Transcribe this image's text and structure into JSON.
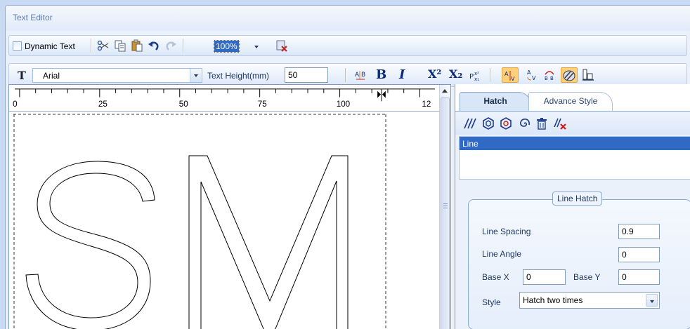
{
  "window": {
    "title": "Text Editor"
  },
  "toolbar1": {
    "dynamic_text_label": "Dynamic Text",
    "zoom_value": "100%",
    "icons": [
      "cut-icon",
      "copy-icon",
      "paste-icon",
      "undo-icon",
      "redo-icon",
      "clear-icon"
    ]
  },
  "toolbar2": {
    "font_name": "Arial",
    "text_height_label": "Text Height(mm)",
    "text_height_value": "50",
    "bold_glyph": "B",
    "italic_glyph": "I",
    "superscript_glyph": "X²",
    "subscript_glyph": "X₂"
  },
  "ruler": {
    "labels": [
      "0",
      "25",
      "50",
      "75",
      "100",
      "12"
    ]
  },
  "panel": {
    "tabs": [
      {
        "label": "Hatch",
        "active": true
      },
      {
        "label": "Advance Style",
        "active": false
      }
    ],
    "hatch_list": [
      "Line"
    ],
    "group": {
      "title": "Line Hatch",
      "line_spacing_label": "Line Spacing",
      "line_spacing_value": "0.9",
      "line_angle_label": "Line Angle",
      "line_angle_value": "0",
      "base_x_label": "Base X",
      "base_x_value": "0",
      "base_y_label": "Base Y",
      "base_y_value": "0",
      "style_label": "Style",
      "style_value": "Hatch two times"
    }
  },
  "colors": {
    "accent": "#316ac5",
    "frame": "#8fa9d2"
  }
}
